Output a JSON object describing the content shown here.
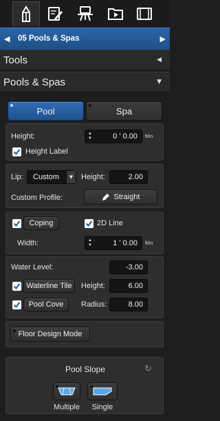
{
  "toolbar": {
    "tabs": [
      {
        "icon": "pencil-pen-icon"
      },
      {
        "icon": "pen-on-sheet-icon"
      },
      {
        "icon": "billboard-robot-icon"
      },
      {
        "icon": "video-play-icon"
      },
      {
        "icon": "film-strip-icon"
      }
    ]
  },
  "layer_bar": {
    "title": "05 Pools & Spas",
    "prev_icon": "◀",
    "next_icon": "▶"
  },
  "sections": {
    "tools": "Tools",
    "tools_toggle": "◀",
    "pools": "Pools & Spas",
    "pools_toggle": "▼"
  },
  "type_toggle": {
    "pool": "Pool",
    "spa": "Spa"
  },
  "height_group": {
    "height_label": "Height:",
    "height_value": "0 ' 0.00",
    "unit": "ft/in",
    "height_label_check": "Height Label"
  },
  "lip_group": {
    "lip_label": "Lip:",
    "lip_value": "Custom",
    "height_label": "Height:",
    "height_value": "2.00",
    "profile_label": "Custom Profile:",
    "profile_button": "Straight"
  },
  "coping_group": {
    "coping_label": "Coping",
    "line_2d_label": "2D Line",
    "width_label": "Width:",
    "width_value": "1 ' 0.00",
    "unit": "ft/in"
  },
  "water_group": {
    "water_level_label": "Water Level:",
    "water_level_value": "-3.00",
    "waterline_tile_label": "Waterline Tile",
    "tile_height_label": "Height:",
    "tile_height_value": "6.00",
    "pool_cove_label": "Pool Cove",
    "radius_label": "Radius:",
    "radius_value": "8.00"
  },
  "floor_design": {
    "label": "Floor Design Mode"
  },
  "pool_slope": {
    "title": "Pool Slope",
    "reset_icon": "↻",
    "multiple": "Multiple",
    "single": "Single"
  },
  "colors": {
    "accent": "#2563a8",
    "panel": "#2e2e2e",
    "field": "#151515"
  }
}
